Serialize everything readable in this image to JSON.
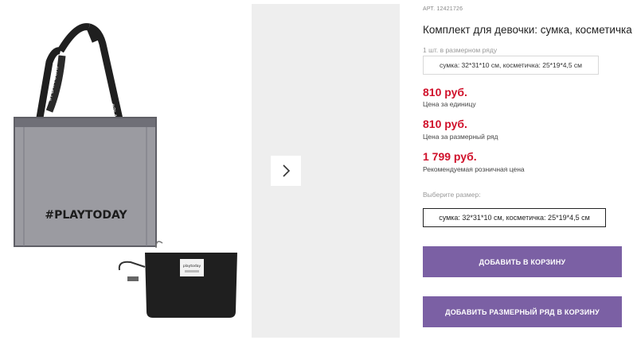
{
  "product": {
    "article_label": "АРТ.",
    "article_number": "12421726",
    "title": "Комплект для девочки: сумка, косметичка",
    "bag_print": "#PLAYTODAY",
    "strap_text": "#PLAYTODAY",
    "pouch_label": "playtoday"
  },
  "size_row": {
    "label": "1 шт. в размерном ряду",
    "value": "сумка: 32*31*10 см, косметичка: 25*19*4,5 см"
  },
  "prices": [
    {
      "amount": "810 руб.",
      "caption": "Цена за единицу"
    },
    {
      "amount": "810 руб.",
      "caption": "Цена за размерный ряд"
    },
    {
      "amount": "1 799 руб.",
      "caption": "Рекомендуемая розничная цена"
    }
  ],
  "size_select": {
    "label": "Выберите размер:",
    "option": "сумка: 32*31*10 см, косметичка: 25*19*4,5 см"
  },
  "buttons": {
    "add_to_cart": "Добавить в корзину",
    "add_size_row": "Добавить размерный ряд в корзину"
  },
  "colors": {
    "price": "#d0112b",
    "button": "#7b60a4"
  },
  "icons": {
    "next": "chevron-right-icon"
  }
}
